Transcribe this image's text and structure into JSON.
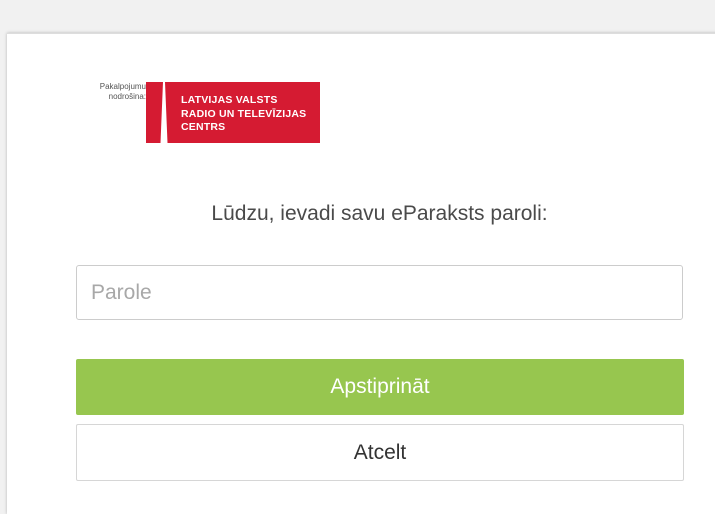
{
  "provider_label": [
    "Pakalpojumu",
    "nodrošina:"
  ],
  "logo": {
    "lines": [
      "LATVIJAS VALSTS",
      "RADIO UN TELEVĪZIJAS",
      "CENTRS"
    ],
    "color": "#d51b32"
  },
  "prompt": "Lūdzu, ievadi savu eParaksts paroli:",
  "password": {
    "placeholder": "Parole",
    "value": ""
  },
  "buttons": {
    "confirm_label": "Apstiprināt",
    "cancel_label": "Atcelt",
    "confirm_color": "#97c64f"
  }
}
